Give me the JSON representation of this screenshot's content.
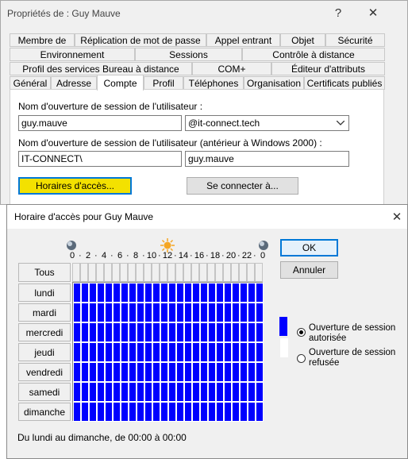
{
  "outer_window": {
    "title": "Propriétés de : Guy Mauve",
    "help_glyph": "?",
    "close_glyph": "✕",
    "tabs_row1": [
      "Membre de",
      "Réplication de mot de passe",
      "Appel entrant",
      "Objet",
      "Sécurité"
    ],
    "tabs_row2": [
      "Environnement",
      "Sessions",
      "Contrôle à distance"
    ],
    "tabs_row3": [
      "Profil des services Bureau à distance",
      "COM+",
      "Éditeur d'attributs"
    ],
    "tabs_row4": [
      "Général",
      "Adresse",
      "Compte",
      "Profil",
      "Téléphones",
      "Organisation",
      "Certificats publiés"
    ],
    "selected_tab": "Compte",
    "logon_label": "Nom d'ouverture de session de l'utilisateur :",
    "logon_value": "guy.mauve",
    "domain_value": "@it-connect.tech",
    "logon_pre2000_label": "Nom d'ouverture de session de l'utilisateur (antérieur à Windows 2000) :",
    "pre2000_domain": "IT-CONNECT\\",
    "pre2000_user": "guy.mauve",
    "hours_button": "Horaires d'accès...",
    "connect_button": "Se connecter à..."
  },
  "dialog": {
    "title": "Horaire d'accès pour Guy Mauve",
    "close_glyph": "✕",
    "hour_labels": [
      "0",
      "2",
      "4",
      "6",
      "8",
      "10",
      "12",
      "14",
      "16",
      "18",
      "20",
      "22",
      "0"
    ],
    "all_button": "Tous",
    "days": [
      "lundi",
      "mardi",
      "mercredi",
      "jeudi",
      "vendredi",
      "samedi",
      "dimanche"
    ],
    "ok_button": "OK",
    "cancel_button": "Annuler",
    "legend_allowed_1": "Ouverture de session",
    "legend_allowed_2": "autorisée",
    "legend_denied_1": "Ouverture de session",
    "legend_denied_2": "refusée",
    "status": "Du lundi au dimanche, de 00:00 à 00:00",
    "allowed_selected": true,
    "colors": {
      "allowed": "#0000ff",
      "denied": "#ffffff",
      "sun": "#f5a623"
    }
  }
}
